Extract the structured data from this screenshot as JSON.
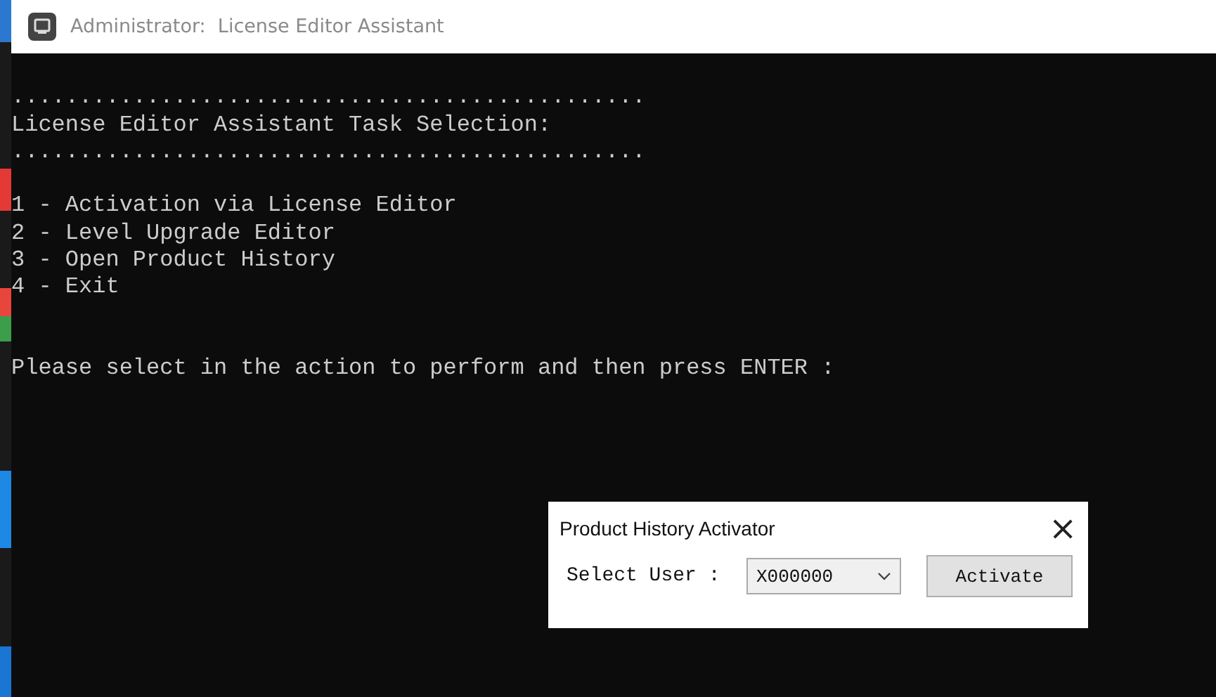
{
  "window": {
    "title": "Administrator:  License Editor Assistant"
  },
  "console": {
    "blocks": [
      [
        "...............................................",
        "License Editor Assistant Task Selection:",
        "..............................................."
      ],
      [
        "1 - Activation via License Editor",
        "2 - Level Upgrade Editor",
        "3 - Open Product History",
        "4 - Exit"
      ],
      [
        "Please select in the action to perform and then press ENTER :"
      ]
    ]
  },
  "dialog": {
    "title": "Product History Activator",
    "close": "×",
    "field_label": "Select User :",
    "user_select": {
      "value": "X000000"
    },
    "button": "Activate"
  }
}
